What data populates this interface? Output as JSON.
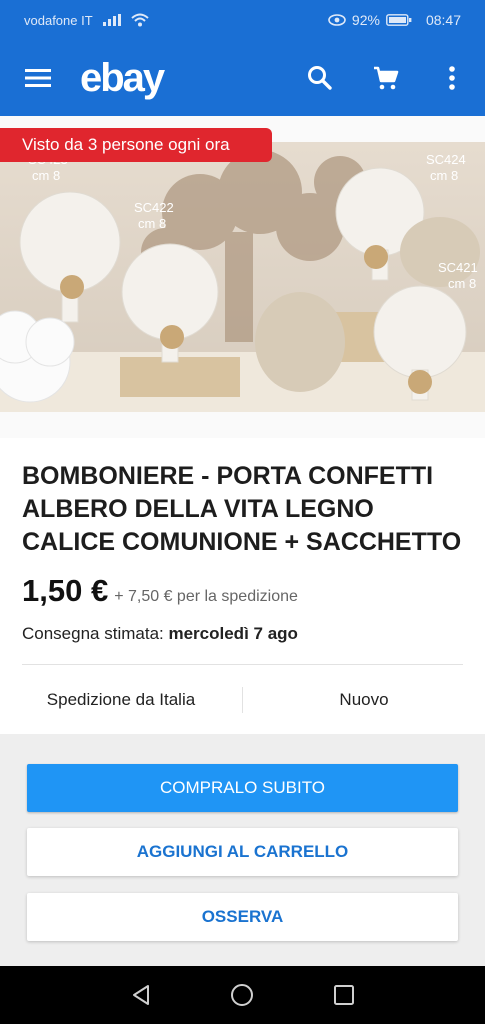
{
  "status_bar": {
    "carrier": "vodafone IT",
    "battery": "92%",
    "time": "08:47"
  },
  "app_bar": {
    "logo": "ebay",
    "icons": [
      "menu-icon",
      "search-icon",
      "cart-icon",
      "more-vert-icon"
    ]
  },
  "hero": {
    "views_badge": "Visto da 3 persone ogni ora",
    "photo_labels": [
      {
        "code": "SC423",
        "size": "cm 8"
      },
      {
        "code": "SC422",
        "size": "cm 8"
      },
      {
        "code": "SC424",
        "size": "cm 8"
      },
      {
        "code": "SC421",
        "size": "cm 8"
      }
    ]
  },
  "item": {
    "title": "BOMBONIERE - PORTA CONFETTI ALBERO DELLA VITA LEGNO CALICE COMUNIONE + SACCHETTO",
    "price": "1,50 €",
    "shipping": "+ 7,50 € per la spedizione",
    "delivery_label": "Consegna stimata:",
    "delivery_date": "mercoledì 7 ago",
    "ships_from": "Spedizione da Italia",
    "condition": "Nuovo"
  },
  "actions": {
    "buy_now": "COMPRALO SUBITO",
    "add_to_cart": "AGGIUNGI AL CARRELLO",
    "watch": "OSSERVA"
  },
  "colors": {
    "brand_blue": "#1a6fd4",
    "buy_button": "#1f95f5",
    "badge_red": "#e0262e"
  }
}
